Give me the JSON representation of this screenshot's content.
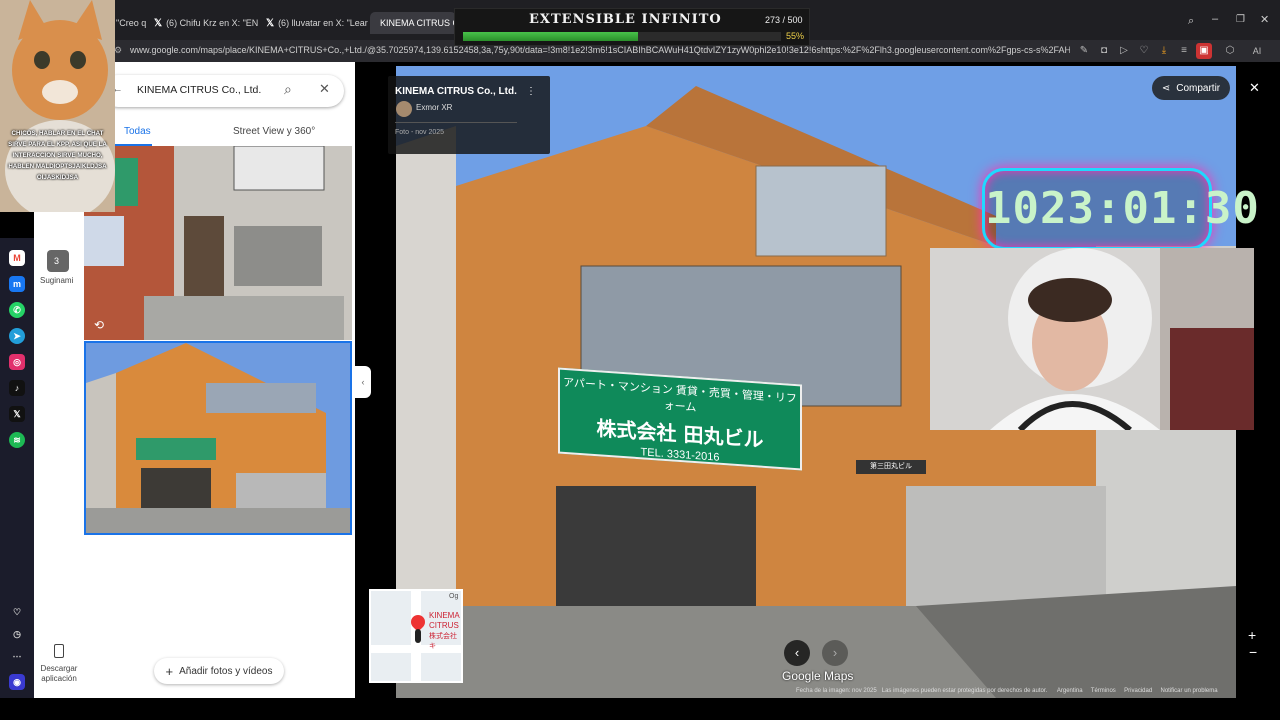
{
  "browser": {
    "tabs": [
      {
        "label": "\"Creo q",
        "icon": ""
      },
      {
        "label": "(6) Chifu Krz en X: \"EN DIR",
        "icon": "X"
      },
      {
        "label": "(6) lluvatar en X: \"Learning",
        "icon": "X"
      },
      {
        "label": "KINEMA CITRUS Co",
        "icon": "maps"
      }
    ],
    "url": "www.google.com/maps/place/KINEMA+CITRUS+Co.,+Ltd./@35.7025974,139.6152458,3a,75y,90t/data=!3m8!1e2!3m6!1sCIABIhBCAWuH41QtdvIZY1zyW0phl2e10!3e12!6shttps:%2F%2Flh3.googleusercontent.com%2Fgps-cs-s%2FAHRPTWmB4c-r",
    "ai_label": "AI"
  },
  "progress_overlay": {
    "title": "EXTENSIBLE INFINITO",
    "count": "273 / 500",
    "percent_label": "55%",
    "fraction": 0.55
  },
  "cat_overlay": {
    "caption": "CHICOS, HABLAR EN EL CHAT SIRVE PARA EL KPP, ASI QUE LA INTERACCION SIRVE MUCHO, HABLEN MALDIOPTSJAIKLDJSA OIJASKIDJSA"
  },
  "rail": {
    "saved_badge": "3",
    "saved_label": "Suginami",
    "download_label": "Descargar aplicación"
  },
  "panel": {
    "search_value": "KINEMA CITRUS Co., Ltd.",
    "tabs": [
      "Todas",
      "Street View y 360°"
    ],
    "add_button": "Añadir fotos y vídeos"
  },
  "streetview": {
    "place_title": "KINEMA CITRUS Co., Ltd.",
    "author": "Exmor XR",
    "photo_date": "Foto - nov 2025",
    "share_label": "Compartir",
    "sign_top": "アパート・マンション 賃貸・売買・管理・リフォーム",
    "sign_main": "株式会社 田丸ビル",
    "sign_tel": "TEL. 3331-2016",
    "small_sign": "第三田丸ビル",
    "minimap_label1": "KINEMA",
    "minimap_label2": "CITRUS",
    "minimap_label3": "株式会社キ",
    "minimap_corner": "Og",
    "brand": "Google Maps",
    "footer": [
      "Fecha de la imagen: nov 2025",
      "Las imágenes pueden estar protegidas por derechos de autor.",
      "Argentina",
      "Términos",
      "Privacidad",
      "Notificar un problema"
    ]
  },
  "timer": "1023:01:30"
}
